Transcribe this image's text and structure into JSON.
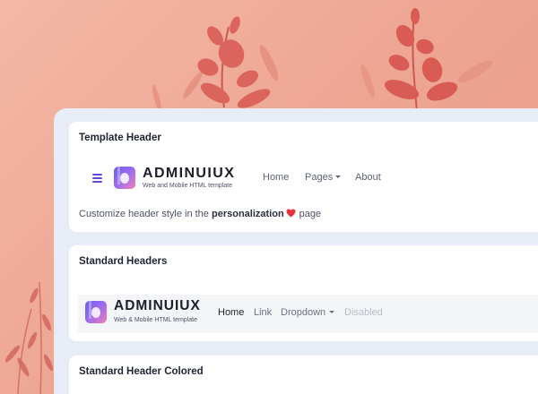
{
  "template_header": {
    "title": "Template Header",
    "brand": "ADMINUIUX",
    "tagline": "Web and Mobile HTML template",
    "nav": {
      "home": "Home",
      "pages": "Pages",
      "about": "About"
    },
    "note_prefix": "Customize header style in the",
    "note_bold": "personalization",
    "note_suffix": "page"
  },
  "standard_headers": {
    "title": "Standard Headers",
    "brand": "ADMINUIUX",
    "tagline": "Web & Mobile HTML template",
    "nav": {
      "home": "Home",
      "link": "Link",
      "dropdown": "Dropdown",
      "disabled": "Disabled"
    }
  },
  "standard_header_colored": {
    "title": "Standard Header Colored"
  },
  "icons": {
    "menu": "hamburger-menu-icon",
    "heart": "heart-icon",
    "caret": "caret-down-icon",
    "logo": "adminuiux-logo-icon"
  },
  "colors": {
    "background": "#eea794",
    "accent": "#5c4ad8",
    "heart": "#e5323b",
    "panel": "#e8ecf7"
  }
}
